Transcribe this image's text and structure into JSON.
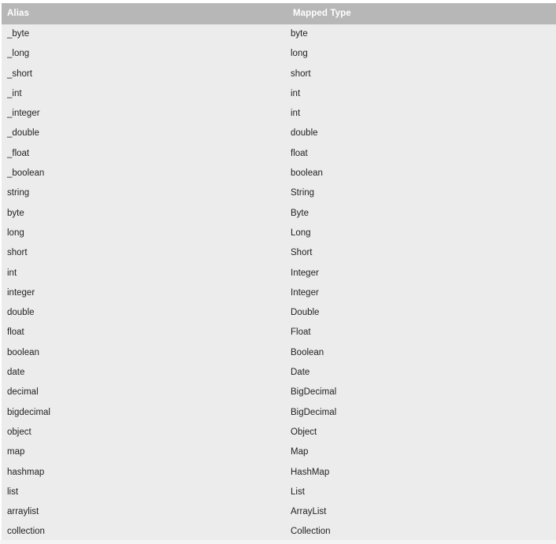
{
  "table": {
    "columns": [
      {
        "key": "alias",
        "label": "Alias"
      },
      {
        "key": "mapped_type",
        "label": "Mapped Type"
      }
    ],
    "rows": [
      {
        "alias": "_byte",
        "mapped_type": "byte"
      },
      {
        "alias": "_long",
        "mapped_type": "long"
      },
      {
        "alias": "_short",
        "mapped_type": "short"
      },
      {
        "alias": "_int",
        "mapped_type": "int"
      },
      {
        "alias": "_integer",
        "mapped_type": "int"
      },
      {
        "alias": "_double",
        "mapped_type": "double"
      },
      {
        "alias": "_float",
        "mapped_type": "float"
      },
      {
        "alias": "_boolean",
        "mapped_type": "boolean"
      },
      {
        "alias": "string",
        "mapped_type": "String"
      },
      {
        "alias": "byte",
        "mapped_type": "Byte"
      },
      {
        "alias": "long",
        "mapped_type": "Long"
      },
      {
        "alias": "short",
        "mapped_type": "Short"
      },
      {
        "alias": "int",
        "mapped_type": "Integer"
      },
      {
        "alias": "integer",
        "mapped_type": "Integer"
      },
      {
        "alias": "double",
        "mapped_type": "Double"
      },
      {
        "alias": "float",
        "mapped_type": "Float"
      },
      {
        "alias": "boolean",
        "mapped_type": "Boolean"
      },
      {
        "alias": "date",
        "mapped_type": "Date"
      },
      {
        "alias": "decimal",
        "mapped_type": "BigDecimal"
      },
      {
        "alias": "bigdecimal",
        "mapped_type": "BigDecimal"
      },
      {
        "alias": "object",
        "mapped_type": "Object"
      },
      {
        "alias": "map",
        "mapped_type": "Map"
      },
      {
        "alias": "hashmap",
        "mapped_type": "HashMap"
      },
      {
        "alias": "list",
        "mapped_type": "List"
      },
      {
        "alias": "arraylist",
        "mapped_type": "ArrayList"
      },
      {
        "alias": "collection",
        "mapped_type": "Collection"
      }
    ]
  },
  "colors": {
    "header_background": "#b7b7b7",
    "header_text": "#ffffff",
    "body_background": "#ececec",
    "body_text": "#222222",
    "page_background": "#ffffff",
    "footer_strip": "#f4f4f4"
  }
}
